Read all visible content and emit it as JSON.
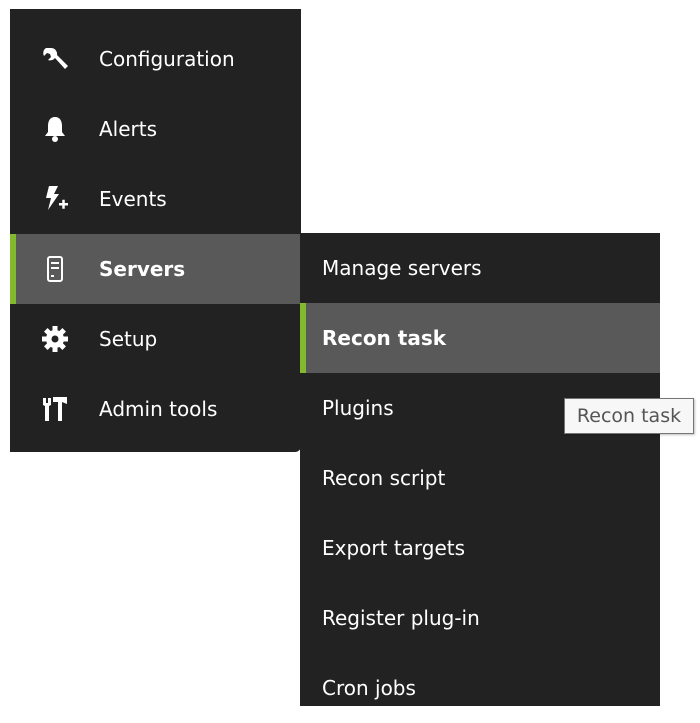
{
  "main_menu": {
    "items": [
      {
        "label": "Configuration",
        "icon": "wrench-icon",
        "active": false
      },
      {
        "label": "Alerts",
        "icon": "bell-icon",
        "active": false
      },
      {
        "label": "Events",
        "icon": "events-bolt-icon",
        "active": false
      },
      {
        "label": "Servers",
        "icon": "server-icon",
        "active": true
      },
      {
        "label": "Setup",
        "icon": "gear-icon",
        "active": false
      },
      {
        "label": "Admin tools",
        "icon": "admin-tools-icon",
        "active": false
      }
    ]
  },
  "submenu": {
    "parent": "Servers",
    "items": [
      {
        "label": "Manage servers",
        "active": false
      },
      {
        "label": "Recon task",
        "active": true
      },
      {
        "label": "Plugins",
        "active": false
      },
      {
        "label": "Recon script",
        "active": false
      },
      {
        "label": "Export targets",
        "active": false
      },
      {
        "label": "Register plug-in",
        "active": false
      },
      {
        "label": "Cron jobs",
        "active": false
      }
    ]
  },
  "tooltip": {
    "text": "Recon task"
  },
  "colors": {
    "menu_background": "#222222",
    "active_background": "#595959",
    "accent": "#82b92e",
    "text": "#ffffff"
  }
}
